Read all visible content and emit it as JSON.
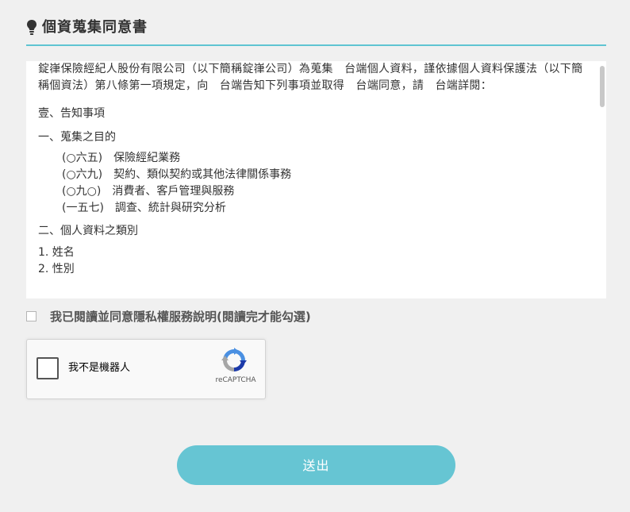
{
  "header": {
    "icon": "lightbulb-icon",
    "title": "個資蒐集同意書",
    "accent_color": "#5fc4d2"
  },
  "terms": {
    "intro": "錠嵂保險經紀人股份有限公司（以下簡稱錠嵂公司）為蒐集　台端個人資料，謹依據個人資料保護法（以下簡稱個資法）第八條第一項規定，向　台端告知下列事項並取得　台端同意，請　台端詳閱：",
    "section_1": "壹、告知事項",
    "section_1_1": "一、蒐集之目的",
    "purposes": [
      "(○六五)　保險經紀業務",
      "(○六九)　契約、類似契約或其他法律關係事務",
      "(○九○)　消費者、客戶管理與服務",
      "(一五七)　調查、統計與研究分析"
    ],
    "section_1_2": "二、個人資料之類別",
    "categories": [
      "1. 姓名",
      "2. 性別"
    ]
  },
  "agree": {
    "label": "我已閱讀並同意隱私權服務說明(閱讀完才能勾選)",
    "checked": false
  },
  "recaptcha": {
    "label": "我不是機器人",
    "brand": "reCAPTCHA",
    "icon": "recaptcha-logo-icon"
  },
  "submit": {
    "label": "送出",
    "color": "#66c5d3"
  }
}
